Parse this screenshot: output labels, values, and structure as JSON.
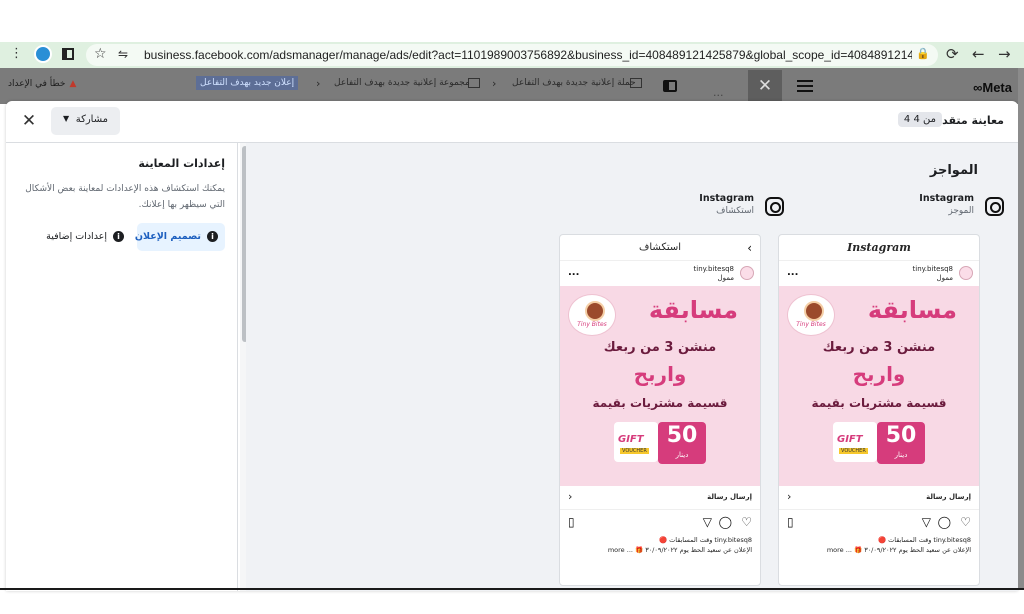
{
  "browser": {
    "url": "business.facebook.com/adsmanager/manage/ads/edit?act=1101989003756892&business_id=408489121425879&business_id=408489121425879&global_scope_id=408489121425879&n...",
    "url_display": "business.facebook.com/adsmanager/manage/ads/edit?act=1101989003756892&business_id=408489121425879&global_scope_id=408489121425879&n...",
    "icons": {
      "menu": "⋮",
      "star": "☆",
      "tune": "⇋",
      "lock": "🔒",
      "reload": "⟳",
      "back": "←",
      "forward": "→"
    }
  },
  "ads_manager": {
    "brand": "∞Meta",
    "breadcrumbs": [
      {
        "label": "حملة إعلانية جديدة بهدف التفاعل"
      },
      {
        "label": "مجموعة إعلانية جديدة بهدف التفاعل"
      },
      {
        "label": "إعلان جديد بهدف التفاعل"
      }
    ],
    "separator": "›",
    "error_text": "خطأ في الإعداد",
    "close_glyph": "✕",
    "more_glyph": "..."
  },
  "modal": {
    "title": "معاينة متقدمة",
    "counter": "4 من 4",
    "share_label": "مشاركة",
    "share_caret": "▼",
    "close_glyph": "✕"
  },
  "settings": {
    "title": "إعدادات المعاينة",
    "description": "يمكنك استكشاف هذه الإعدادات لمعاينة بعض الأشكال التي سيظهر بها إعلانك.",
    "tabs": [
      {
        "label": "تصميم الإعلان",
        "selected": true
      },
      {
        "label": "إعدادات إضافية",
        "selected": false
      }
    ],
    "info_glyph": "i"
  },
  "preview": {
    "section_title": "المواجز",
    "placements": [
      {
        "platform": "Instagram",
        "name": "الموجز",
        "header": "Instagram",
        "header_is_logo": true,
        "has_back": false
      },
      {
        "platform": "Instagram",
        "name": "استكشاف",
        "header": "استكشاف",
        "header_is_logo": false,
        "has_back": true
      }
    ],
    "post": {
      "username": "tiny.bitesq8",
      "sponsored": "ممول",
      "more_dots": "...",
      "creative": {
        "headline": "مسابقة",
        "line1": "منشن 3 من ربعك",
        "line2": "واربح",
        "line3": "قسيمة مشتريات بقيمة",
        "logo_text": "Tiny Bites",
        "gift_text": "GIFT",
        "voucher_text": "VOUCHER",
        "amount": "50",
        "currency": "دينار"
      },
      "cta": "إرسال رسالة",
      "cta_chevron": "›",
      "caption": "tiny.bitesq8 وقت المسابقات 🔴",
      "caption_line2": "الإعلان عن سعيد الحظ يوم ٣٠/٠٩/٢٠٢٢ 🎁 ... more"
    },
    "action_icons": [
      "heart-icon",
      "comment-icon",
      "share-icon",
      "bookmark-icon"
    ]
  },
  "colors": {
    "accent_blue": "#1d5fbf",
    "selected_tab_bg": "#e7f3ff",
    "creative_pink": "#d63c7c",
    "creative_bg": "#f8d9e5",
    "browser_bar": "#dff0e0"
  }
}
